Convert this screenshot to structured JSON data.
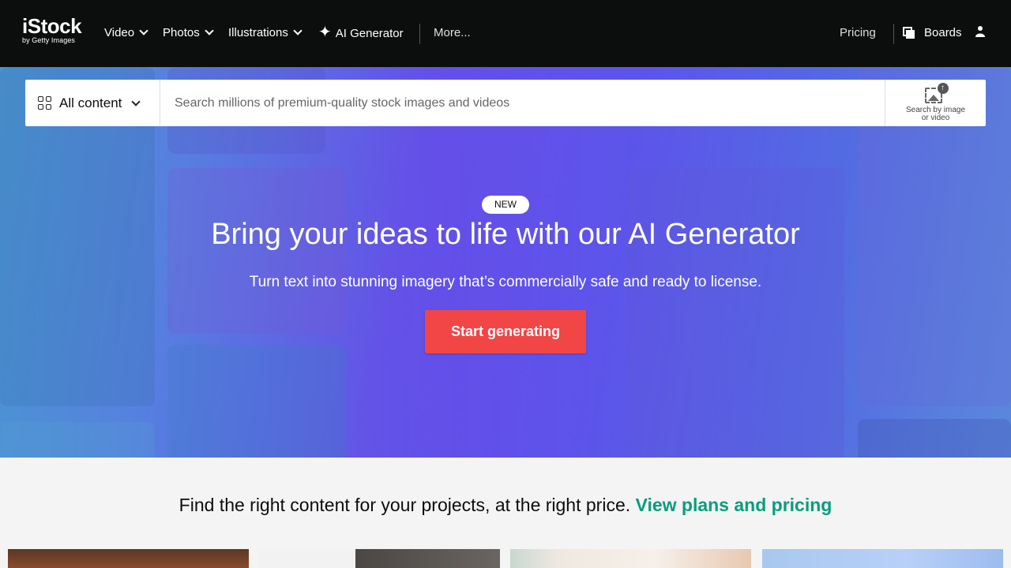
{
  "nav": {
    "logo_main": "iStock",
    "logo_sub": "by Getty Images",
    "items": [
      {
        "label": "Video",
        "has_dropdown": true
      },
      {
        "label": "Photos",
        "has_dropdown": true
      },
      {
        "label": "Illustrations",
        "has_dropdown": true
      },
      {
        "label": "AI Generator",
        "icon": "sparkle-icon"
      },
      {
        "label": "More..."
      }
    ],
    "pricing": "Pricing",
    "boards": "Boards"
  },
  "search": {
    "filter_label": "All content",
    "placeholder": "Search millions of premium-quality stock images and videos",
    "image_search_label_1": "Search by image",
    "image_search_label_2": "or video"
  },
  "hero": {
    "badge": "NEW",
    "title": "Bring your ideas to life with our AI Generator",
    "subtitle": "Turn text into stunning imagery that’s commercially safe and ready to license.",
    "cta": "Start generating"
  },
  "pricing_strip": {
    "text": "Find the right content for your projects, at the right price.",
    "link": "View plans and pricing"
  },
  "colors": {
    "nav_bg": "#0c0d0d",
    "cta": "#f24545",
    "link": "#069e7d"
  }
}
